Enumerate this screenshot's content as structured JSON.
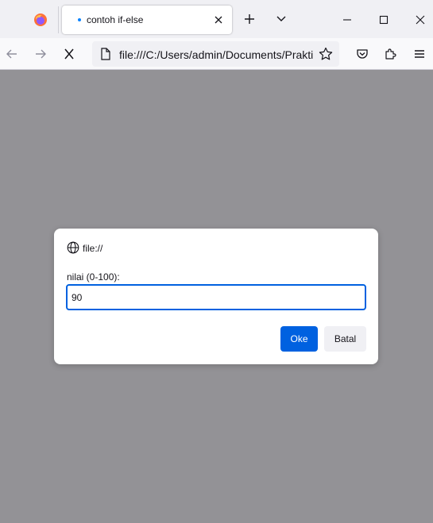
{
  "browser": {
    "tab": {
      "title": "contoh if-else"
    },
    "url": "file:///C:/Users/admin/Documents/Praktikum"
  },
  "icons": {
    "firefox": "firefox-logo",
    "tab_close": "close-icon",
    "new_tab": "plus-icon",
    "tab_list": "chevron-down-icon",
    "minimize": "minimize-icon",
    "maximize": "maximize-icon",
    "window_close": "close-icon",
    "back": "arrow-left-icon",
    "forward": "arrow-right-icon",
    "stop": "stop-icon",
    "page": "document-icon",
    "bookmark": "star-icon",
    "pocket": "pocket-icon",
    "extensions": "puzzle-icon",
    "menu": "hamburger-icon",
    "origin": "globe-icon"
  },
  "colors": {
    "accent": "#0061e0",
    "loading_dot": "#0a84ff",
    "overlay": "#939296"
  },
  "dialog": {
    "origin": "file://",
    "label": "nilai (0-100):",
    "value": "90",
    "ok_label": "Oke",
    "cancel_label": "Batal"
  }
}
